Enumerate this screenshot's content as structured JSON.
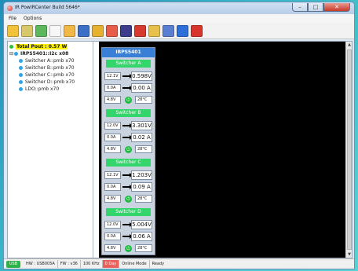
{
  "window": {
    "title": "IR PowIRCenter Build 5646*"
  },
  "menu": [
    "File",
    "Options"
  ],
  "toolbar": {
    "icons": [
      {
        "name": "new-icon",
        "color": "#f2c33a"
      },
      {
        "name": "grid-icon",
        "color": "#d9c86a"
      },
      {
        "name": "tree-icon",
        "color": "#5cb85c"
      },
      {
        "name": "document-icon",
        "color": "#f7f7f7"
      },
      {
        "name": "folder-icon",
        "color": "#f2b845"
      },
      {
        "name": "save-icon",
        "color": "#3b6fc7"
      },
      {
        "name": "settings-icon",
        "color": "#e6b12f"
      },
      {
        "name": "chart-icon",
        "color": "#e85d4a"
      },
      {
        "name": "vout-icon",
        "color": "#3d3d8c"
      },
      {
        "name": "tune-icon",
        "color": "#d63a2f"
      },
      {
        "name": "flash-icon",
        "color": "#e7c14b"
      },
      {
        "name": "bus-icon",
        "color": "#5a7fd1"
      },
      {
        "name": "chip-icon",
        "color": "#2d6fd8"
      },
      {
        "name": "help-icon",
        "color": "#d9342b"
      }
    ]
  },
  "tree": {
    "root": "Total Pout : 0.57 W",
    "device": "IRPS5401::I2c x08",
    "items": [
      "Switcher A::pmb x70",
      "Switcher B::pmb x70",
      "Switcher C::pmb x70",
      "Switcher D::pmb x70",
      "LDO::pmb x70"
    ]
  },
  "panel": {
    "title": "IRPS5401",
    "switchers": [
      {
        "name": "Switcher A",
        "vin": "12.1V",
        "vout": "0.598V",
        "iin": "0.0A",
        "iout": "0.00 A",
        "vaux": "4.8V",
        "temp": "28°C"
      },
      {
        "name": "Switcher B",
        "vin": "12.0V",
        "vout": "3.301V",
        "iin": "0.0A",
        "iout": "0.02 A",
        "vaux": "4.8V",
        "temp": "28°C"
      },
      {
        "name": "Switcher C",
        "vin": "12.1V",
        "vout": "1.203V",
        "iin": "0.0A",
        "iout": "0.09 A",
        "vaux": "4.8V",
        "temp": "28°C"
      },
      {
        "name": "Switcher D",
        "vin": "12.0V",
        "vout": "5.004V",
        "iin": "0.0A",
        "iout": "0.06 A",
        "vaux": "4.8V",
        "temp": "28°C"
      }
    ]
  },
  "status": {
    "usb_label": "USB",
    "hw": "HW : USB005A",
    "fw": "FW : v36",
    "freq": "100 KHz",
    "days": "0 Day",
    "mode": "Online Mode",
    "state": "Ready"
  }
}
